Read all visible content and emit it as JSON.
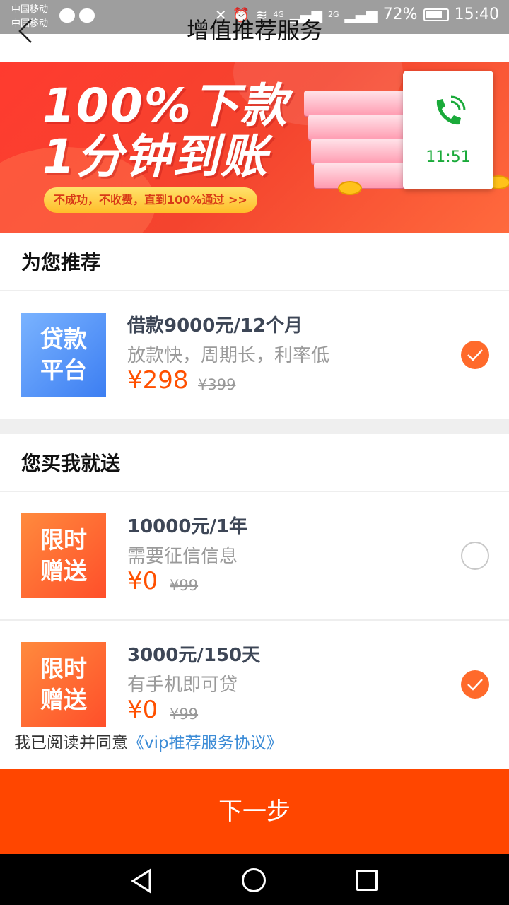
{
  "status_bar": {
    "carrier_1": "中国移动",
    "carrier_2": "中国移动",
    "network_1": "4G",
    "network_2": "2G",
    "battery": "72%",
    "time": "15:40"
  },
  "header": {
    "title": "增值推荐服务"
  },
  "banner": {
    "headline_1": "100%下款",
    "headline_2": "1分钟到账",
    "pill_text": "不成功，不收费，直到100%通过 >>"
  },
  "call_widget": {
    "time": "11:51",
    "accent": "#1aaa3a"
  },
  "recommend": {
    "title": "为您推荐",
    "items": [
      {
        "thumb_line_1": "贷款",
        "thumb_line_2": "平台",
        "title": "借款9000元/12个月",
        "desc": "放款快，周期长，利率低",
        "price": "¥298",
        "original_price": "¥399",
        "checked": true
      }
    ]
  },
  "gift": {
    "title": "您买我就送",
    "items": [
      {
        "thumb_line_1": "限时",
        "thumb_line_2": "赠送",
        "title": "10000元/1年",
        "desc": "需要征信信息",
        "price": "¥0",
        "original_price": "¥99",
        "checked": false
      },
      {
        "thumb_line_1": "限时",
        "thumb_line_2": "赠送",
        "title": "3000元/150天",
        "desc": "有手机即可贷",
        "price": "¥0",
        "original_price": "¥99",
        "checked": true
      }
    ]
  },
  "agreement": {
    "prefix": "我已阅读并同意",
    "link": "《vip推荐服务协议》"
  },
  "footer": {
    "next_label": "下一步"
  },
  "colors": {
    "accent": "#ff4600",
    "price": "#ff5000",
    "link": "#3b8bd6"
  }
}
